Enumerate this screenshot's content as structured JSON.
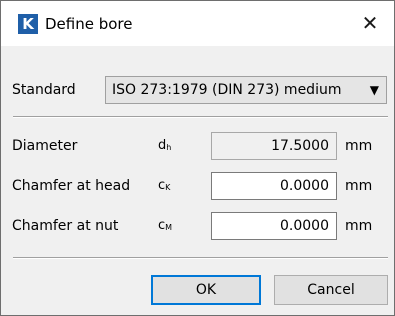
{
  "window": {
    "title": "Define bore",
    "app_icon_letter": "K",
    "close_glyph": "✕"
  },
  "standard": {
    "label": "Standard",
    "selected": "ISO 273:1979 (DIN 273) medium",
    "arrow": "▼"
  },
  "fields": [
    {
      "label": "Diameter",
      "symbol": "d",
      "symbol_sub": "h",
      "value": "17.5000",
      "unit": "mm",
      "readonly": true
    },
    {
      "label": "Chamfer at head",
      "symbol": "c",
      "symbol_sub": "K",
      "value": "0.0000",
      "unit": "mm",
      "readonly": false
    },
    {
      "label": "Chamfer at nut",
      "symbol": "c",
      "symbol_sub": "M",
      "value": "0.0000",
      "unit": "mm",
      "readonly": false
    }
  ],
  "buttons": {
    "ok": "OK",
    "cancel": "Cancel"
  },
  "colors": {
    "app_icon": "#1f5fa8",
    "default_button_border": "#0078d7",
    "dialog_background": "#f0f0f0"
  },
  "icons": {
    "app": "k-logo-icon",
    "close": "close-icon",
    "dropdown": "chevron-down-icon"
  }
}
